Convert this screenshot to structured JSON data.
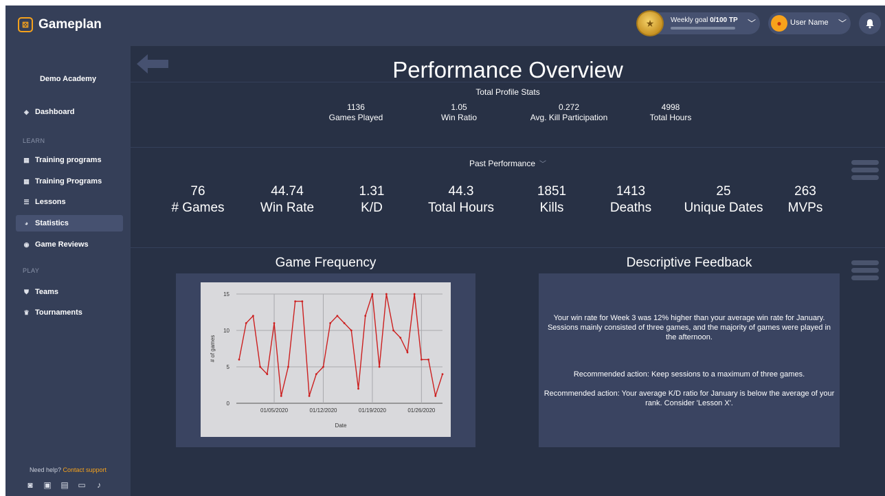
{
  "app": {
    "name": "Gameplan"
  },
  "header": {
    "weekly_goal_label": "Weekly goal",
    "weekly_goal_value": "0/100 TP",
    "weekly_goal_progress": 0,
    "user_name": "User Name"
  },
  "sidebar": {
    "academy": "Demo Academy",
    "dashboard": "Dashboard",
    "learn_label": "LEARN",
    "learn_items": [
      {
        "label": "Training programs"
      },
      {
        "label": "Training Programs"
      },
      {
        "label": "Lessons"
      },
      {
        "label": "Statistics",
        "active": true
      },
      {
        "label": "Game Reviews"
      }
    ],
    "play_label": "PLAY",
    "play_items": [
      {
        "label": "Teams"
      },
      {
        "label": "Tournaments"
      }
    ],
    "help_text": "Need help?",
    "help_link": "Contact support",
    "socials": [
      "instagram-icon",
      "twitter-icon",
      "facebook-icon",
      "twitch-icon",
      "tiktok-icon"
    ]
  },
  "main": {
    "title": "Performance Overview",
    "profile_stats_title": "Total Profile Stats",
    "profile_stats": [
      {
        "value": "1136",
        "label": "Games Played"
      },
      {
        "value": "1.05",
        "label": "Win Ratio"
      },
      {
        "value": "0.272",
        "label": "Avg. Kill Participation"
      },
      {
        "value": "4998",
        "label": "Total Hours"
      }
    ],
    "past_performance_label": "Past Performance",
    "past_stats": [
      {
        "value": "76",
        "label": "# Games"
      },
      {
        "value": "44.74",
        "label": "Win Rate"
      },
      {
        "value": "1.31",
        "label": "K/D"
      },
      {
        "value": "44.3",
        "label": "Total Hours"
      },
      {
        "value": "1851",
        "label": "Kills"
      },
      {
        "value": "1413",
        "label": "Deaths"
      },
      {
        "value": "25",
        "label": "Unique Dates"
      },
      {
        "value": "263",
        "label": "MVPs"
      }
    ],
    "game_frequency_title": "Game Frequency",
    "feedback_title": "Descriptive Feedback",
    "feedback": [
      "Your win rate for Week 3 was 12% higher than your average win rate for January. Sessions mainly consisted of three games, and the majority of games were played in the afternoon.",
      "Recommended action: Keep sessions to a maximum of three games.",
      "Recommended action: Your average K/D ratio for January is below the average of your rank. Consider 'Lesson X'."
    ]
  },
  "chart_data": {
    "type": "line",
    "title": "",
    "xlabel": "Date",
    "ylabel": "# of games",
    "ylim": [
      0,
      15
    ],
    "yticks": [
      0,
      5,
      10,
      15
    ],
    "xticks": [
      "01/05/2020",
      "01/12/2020",
      "01/19/2020",
      "01/26/2020"
    ],
    "x": [
      "2019-12-31",
      "2020-01-01",
      "2020-01-02",
      "2020-01-03",
      "2020-01-04",
      "2020-01-05",
      "2020-01-06",
      "2020-01-07",
      "2020-01-08",
      "2020-01-09",
      "2020-01-10",
      "2020-01-11",
      "2020-01-12",
      "2020-01-13",
      "2020-01-14",
      "2020-01-15",
      "2020-01-16",
      "2020-01-17",
      "2020-01-18",
      "2020-01-19",
      "2020-01-20",
      "2020-01-21",
      "2020-01-22",
      "2020-01-23",
      "2020-01-24",
      "2020-01-25",
      "2020-01-26",
      "2020-01-27",
      "2020-01-28",
      "2020-01-29",
      "2020-01-30"
    ],
    "values": [
      6,
      11,
      12,
      5,
      4,
      11,
      1,
      5,
      14,
      14,
      1,
      4,
      5,
      11,
      12,
      11,
      10,
      2,
      12,
      15,
      5,
      15,
      10,
      9,
      7,
      15,
      6,
      6,
      1,
      4
    ],
    "grid": true,
    "series_color": "#cc1f1f"
  }
}
